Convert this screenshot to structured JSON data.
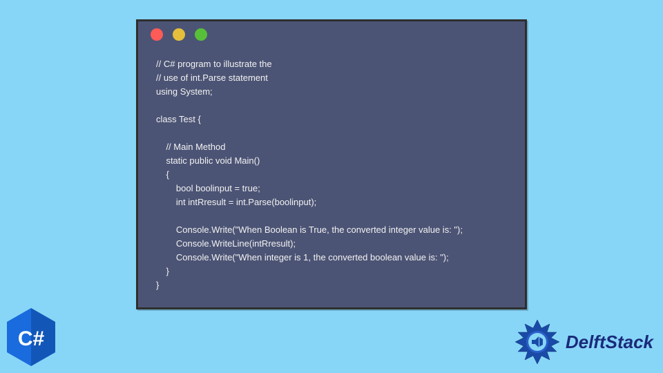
{
  "window": {
    "dots": {
      "red": "#fc5b57",
      "yellow": "#e5bf3c",
      "green": "#57c038"
    }
  },
  "code": {
    "lines": [
      "// C# program to illustrate the",
      "// use of int.Parse statement",
      "using System;",
      "",
      "class Test {",
      "",
      "    // Main Method",
      "    static public void Main()",
      "    {",
      "        bool boolinput = true;",
      "        int intRresult = int.Parse(boolinput);",
      "",
      "        Console.Write(\"When Boolean is True, the converted integer value is: \");",
      "        Console.WriteLine(intRresult);",
      "        Console.Write(\"When integer is 1, the converted boolean value is: \");",
      "    }",
      "}"
    ]
  },
  "logos": {
    "csharp": "C#",
    "delftstack": "DelftStack"
  }
}
